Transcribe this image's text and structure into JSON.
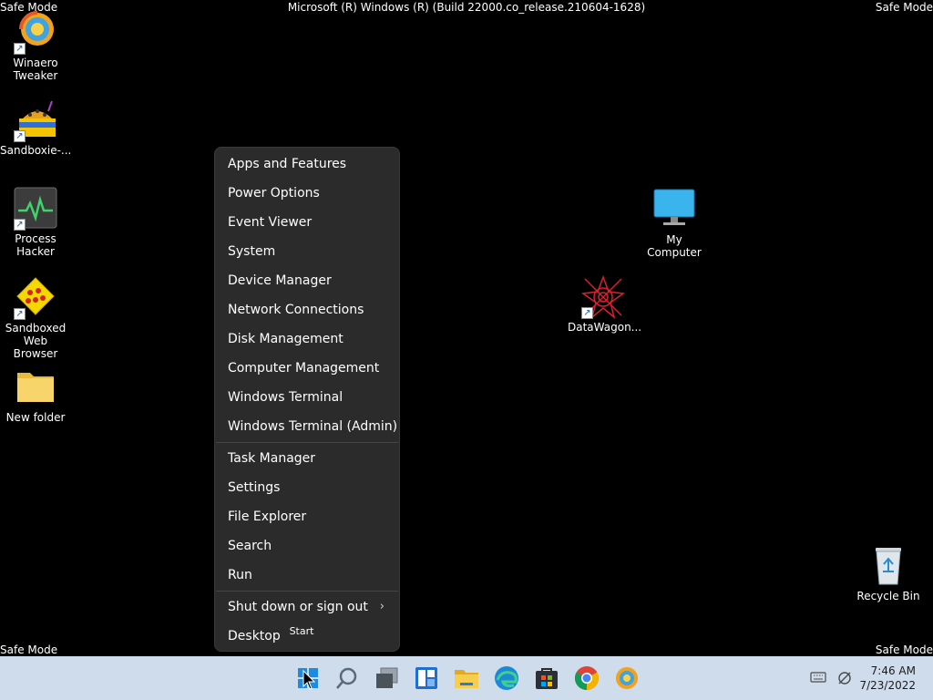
{
  "watermark": {
    "safe_mode": "Safe Mode",
    "build": "Microsoft (R) Windows (R) (Build 22000.co_release.210604-1628)"
  },
  "desktop_icons": [
    {
      "label": "Winaero\nTweaker",
      "icon": "winaero-tweaker-icon"
    },
    {
      "label": "Sandboxie-...",
      "icon": "sandboxie-icon"
    },
    {
      "label": "Process\nHacker",
      "icon": "process-hacker-icon"
    },
    {
      "label": "Sandboxed\nWeb Browser",
      "icon": "sandboxed-browser-icon"
    },
    {
      "label": "New folder",
      "icon": "folder-icon"
    },
    {
      "label": "My Computer",
      "icon": "monitor-icon"
    },
    {
      "label": "DataWagon...",
      "icon": "datawagon-icon"
    },
    {
      "label": "Recycle Bin",
      "icon": "recycle-bin-icon"
    }
  ],
  "menu": {
    "items": [
      "Apps and Features",
      "Power Options",
      "Event Viewer",
      "System",
      "Device Manager",
      "Network Connections",
      "Disk Management",
      "Computer Management",
      "Windows Terminal",
      "Windows Terminal (Admin)",
      "Task Manager",
      "Settings",
      "File Explorer",
      "Search",
      "Run",
      "Shut down or sign out",
      "Desktop"
    ]
  },
  "tooltip": "Start",
  "taskbar": {
    "apps": [
      "start-icon",
      "search-icon",
      "task-view-icon",
      "widgets-icon",
      "file-explorer-icon",
      "edge-icon",
      "store-icon",
      "chrome-icon",
      "winaero-tweaker-icon"
    ],
    "clock_time": "7:46 AM",
    "clock_date": "7/23/2022"
  },
  "colors": {
    "desktop": "#000000",
    "menu_bg": "#2b2b2b",
    "taskbar_bg": "#cfdcec",
    "accent": "#0078d4"
  }
}
